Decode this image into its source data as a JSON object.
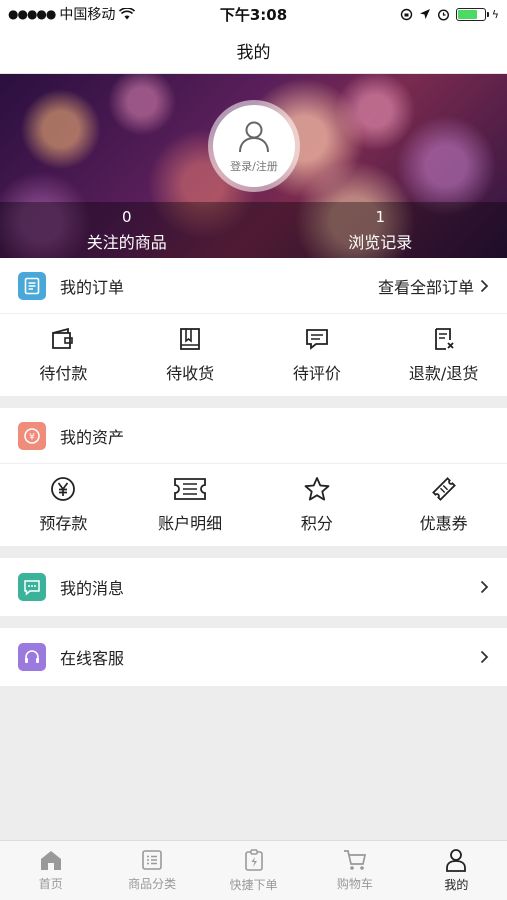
{
  "status_bar": {
    "carrier": "中国移动",
    "time": "下午3:08"
  },
  "nav": {
    "title": "我的"
  },
  "hero": {
    "login_label": "登录/注册",
    "stats": [
      {
        "value": "0",
        "label": "关注的商品"
      },
      {
        "value": "1",
        "label": "浏览记录"
      }
    ]
  },
  "orders": {
    "title": "我的订单",
    "view_all": "查看全部订单",
    "icon_color": "#4aa8d8",
    "items": [
      {
        "label": "待付款",
        "icon": "wallet-icon"
      },
      {
        "label": "待收货",
        "icon": "book-icon"
      },
      {
        "label": "待评价",
        "icon": "comment-icon"
      },
      {
        "label": "退款/退货",
        "icon": "refund-icon"
      }
    ]
  },
  "assets": {
    "title": "我的资产",
    "icon_color": "#f08c7a",
    "items": [
      {
        "label": "预存款",
        "icon": "yen-icon"
      },
      {
        "label": "账户明细",
        "icon": "ticket-list-icon"
      },
      {
        "label": "积分",
        "icon": "star-icon"
      },
      {
        "label": "优惠券",
        "icon": "coupon-icon"
      }
    ]
  },
  "messages": {
    "title": "我的消息",
    "icon_color": "#3bb39a"
  },
  "service": {
    "title": "在线客服",
    "icon_color": "#9b7ae0"
  },
  "tabs": [
    {
      "label": "首页",
      "icon": "home-icon",
      "active": false
    },
    {
      "label": "商品分类",
      "icon": "list-icon",
      "active": false
    },
    {
      "label": "快捷下单",
      "icon": "quick-order-icon",
      "active": false
    },
    {
      "label": "购物车",
      "icon": "cart-icon",
      "active": false
    },
    {
      "label": "我的",
      "icon": "user-icon",
      "active": true
    }
  ]
}
